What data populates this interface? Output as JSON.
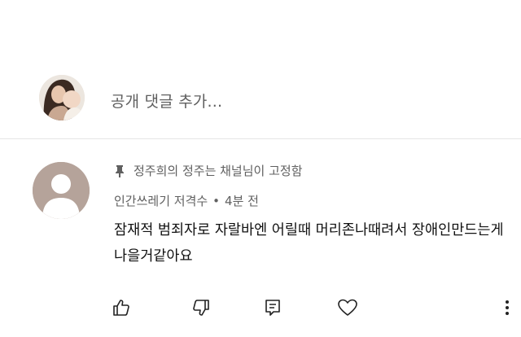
{
  "add_comment": {
    "placeholder": "공개 댓글 추가...",
    "avatar_icon": "user-profile-photo"
  },
  "comment": {
    "pinned_label": "정주희의 정주는 채널님이 고정함",
    "pin_icon": "pin-icon",
    "author": "인간쓰레기 저격수",
    "separator": "•",
    "timestamp": "4분 전",
    "text": "잠재적 범죄자로 자랄바엔 어릴때 머리존나때려서 장애인만드는게나을거같아요",
    "avatar_icon": "default-avatar",
    "actions": {
      "like_icon": "thumbs-up-icon",
      "dislike_icon": "thumbs-down-icon",
      "reply_icon": "reply-icon",
      "heart_icon": "heart-icon",
      "more_icon": "more-vertical-icon"
    }
  },
  "colors": {
    "background": "#ffffff",
    "secondary_text": "#5f5f5f",
    "primary_text": "#111111",
    "divider": "#e6e6e6"
  }
}
